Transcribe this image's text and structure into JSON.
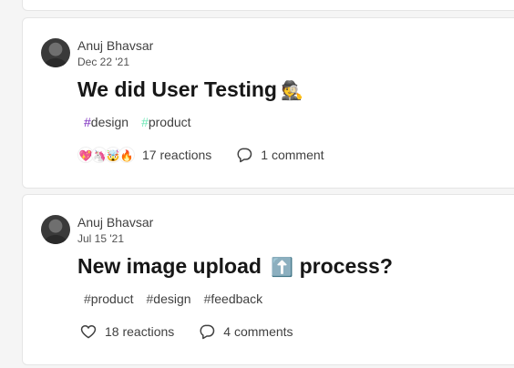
{
  "posts": [
    {
      "author": "Anuj Bhavsar",
      "date": "Dec 22 '21",
      "title": "We did User Testing",
      "title_emoji": "🕵️",
      "tags": [
        "design",
        "product"
      ],
      "reaction_emojis": [
        "💖",
        "🦄",
        "🤯",
        "🔥"
      ],
      "reactions": "17 reactions",
      "comments": "1 comment"
    },
    {
      "author": "Anuj Bhavsar",
      "date": "Jul 15 '21",
      "title_before": "New image upload",
      "title_emoji": "⬆️",
      "title_after": "process?",
      "tags": [
        "product",
        "design",
        "feedback"
      ],
      "reactions": "18 reactions",
      "comments": "4 comments"
    }
  ],
  "icons": {
    "heart": "heart-icon",
    "comment": "comment-icon"
  },
  "colors": {
    "page_bg": "#f5f5f5",
    "card_bg": "#ffffff",
    "tag_design_hash": "#7b2cbf",
    "tag_product_hash": "#6ee7b7"
  }
}
